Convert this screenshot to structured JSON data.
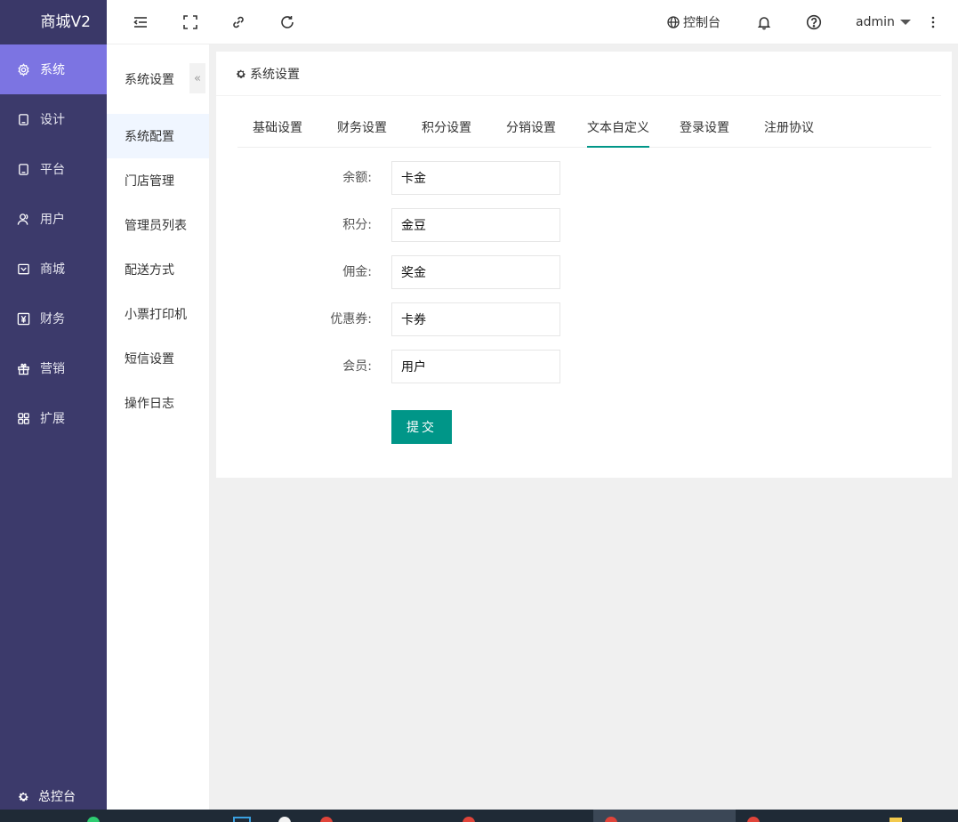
{
  "app": {
    "brand": "商城V2"
  },
  "sidebar": {
    "items": [
      {
        "label": "系统",
        "icon": "gear-icon",
        "active": true
      },
      {
        "label": "设计",
        "icon": "tablet-icon",
        "active": false
      },
      {
        "label": "平台",
        "icon": "tablet-icon",
        "active": false
      },
      {
        "label": "用户",
        "icon": "user-icon",
        "active": false
      },
      {
        "label": "商城",
        "icon": "mail-icon",
        "active": false
      },
      {
        "label": "财务",
        "icon": "yen-icon",
        "active": false
      },
      {
        "label": "营销",
        "icon": "gift-icon",
        "active": false
      },
      {
        "label": "扩展",
        "icon": "grid-icon",
        "active": false
      }
    ],
    "bottom_label": "总控台"
  },
  "topbar": {
    "console_label": "控制台",
    "user_label": "admin",
    "icons": [
      "menu-indent-icon",
      "fullscreen-icon",
      "link-icon",
      "refresh-icon",
      "globe-icon",
      "bell-icon",
      "help-icon",
      "more-vertical-icon"
    ]
  },
  "subnav": {
    "title": "系统设置",
    "collapse_glyph": "«",
    "items": [
      {
        "label": "系统配置",
        "active": true
      },
      {
        "label": "门店管理",
        "active": false
      },
      {
        "label": "管理员列表",
        "active": false
      },
      {
        "label": "配送方式",
        "active": false
      },
      {
        "label": "小票打印机",
        "active": false
      },
      {
        "label": "短信设置",
        "active": false
      },
      {
        "label": "操作日志",
        "active": false
      }
    ]
  },
  "card": {
    "title": "系统设置",
    "tabs": [
      {
        "label": "基础设置",
        "active": false
      },
      {
        "label": "财务设置",
        "active": false
      },
      {
        "label": "积分设置",
        "active": false
      },
      {
        "label": "分销设置",
        "active": false
      },
      {
        "label": "文本自定义",
        "active": true
      },
      {
        "label": "登录设置",
        "active": false
      },
      {
        "label": "注册协议",
        "active": false
      }
    ],
    "fields": [
      {
        "label": "余额:",
        "value": "卡金"
      },
      {
        "label": "积分:",
        "value": "金豆"
      },
      {
        "label": "佣金:",
        "value": "奖金"
      },
      {
        "label": "优惠券:",
        "value": "卡券"
      },
      {
        "label": "会员:",
        "value": "用户"
      }
    ],
    "submit_label": "提交"
  },
  "colors": {
    "sidebar_bg": "#3c3a6b",
    "sidebar_active": "#7c74e2",
    "primary": "#009688"
  }
}
